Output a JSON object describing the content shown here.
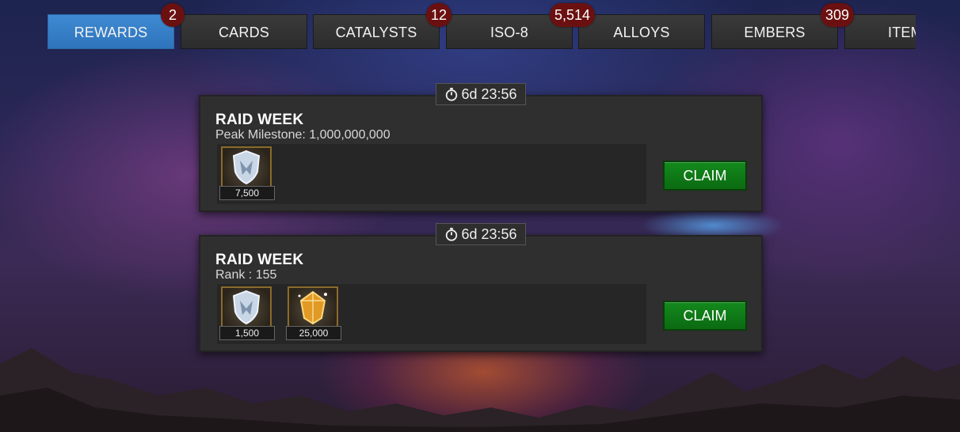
{
  "tabs": [
    {
      "label": "REWARDS",
      "badge": "2"
    },
    {
      "label": "CARDS",
      "badge": ""
    },
    {
      "label": "CATALYSTS",
      "badge": "12"
    },
    {
      "label": "ISO-8",
      "badge": "5,514"
    },
    {
      "label": "ALLOYS",
      "badge": ""
    },
    {
      "label": "EMBERS",
      "badge": "309"
    },
    {
      "label": "ITEMS",
      "badge": ""
    }
  ],
  "rewards": [
    {
      "timer": "6d 23:56",
      "title": "RAID WEEK",
      "subtitle": "Peak Milestone: 1,000,000,000",
      "items": [
        {
          "icon": "raid-shield-icon",
          "count": "7,500"
        }
      ],
      "claim_label": "CLAIM"
    },
    {
      "timer": "6d 23:56",
      "title": "RAID WEEK",
      "subtitle": "Rank : 155",
      "items": [
        {
          "icon": "raid-shield-icon",
          "count": "1,500"
        },
        {
          "icon": "gold-crystal-icon",
          "count": "25,000"
        }
      ],
      "claim_label": "CLAIM"
    }
  ],
  "colors": {
    "active_tab": "#3a84cf",
    "badge": "#6b1010",
    "claim": "#0f7a18"
  }
}
